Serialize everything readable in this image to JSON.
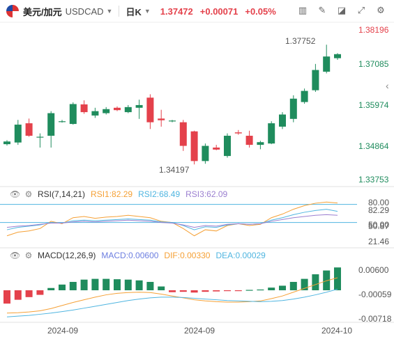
{
  "header": {
    "symbol": "美元/加元",
    "symbol_code": "USDCAD",
    "timeframe": "日K",
    "last_price": "1.37472",
    "change": "+0.00071",
    "change_pct": "+0.05%",
    "tools": [
      "candle-style-icon",
      "draw-icon",
      "drawing-tools-icon",
      "fullscreen-icon",
      "settings-icon"
    ]
  },
  "colors": {
    "up": "#1f8c5d",
    "down": "#e4414b",
    "rsi1": "#f5a035",
    "rsi2": "#4fb5e0",
    "rsi3": "#9b7fd0",
    "macd": "#6c7ee0",
    "dif": "#f5a035",
    "dea": "#4fb5e0"
  },
  "main_axis_labels": [
    "1.38196",
    "1.37085",
    "1.35974",
    "1.34864",
    "1.33753"
  ],
  "rsi_axis_labels": [
    "80.00",
    "82.29",
    "50.00",
    "50.87",
    "21.46"
  ],
  "macd_axis_labels": [
    "0.00600",
    "-0.00059",
    "-0.00718"
  ],
  "x_axis_labels": [
    "2024-09",
    "2024-09",
    "2024-10"
  ],
  "rsi_header": {
    "name": "RSI(7,14,21)",
    "rsi1": "RSI1:82.29",
    "rsi2": "RSI2:68.49",
    "rsi3": "RSI3:62.09"
  },
  "macd_header": {
    "name": "MACD(12,26,9)",
    "macd": "MACD:0.00600",
    "dif": "DIF:0.00330",
    "dea": "DEA:0.00029"
  },
  "chart_data": [
    {
      "type": "candlestick",
      "title": "",
      "ylim": [
        1.3375,
        1.3825
      ],
      "annotations": [
        {
          "text": "1.37752",
          "value": 1.37752
        },
        {
          "text": "1.34197",
          "value": 1.34197
        }
      ],
      "candles": [
        {
          "o": 1.348,
          "h": 1.3492,
          "l": 1.3476,
          "c": 1.3488
        },
        {
          "o": 1.3485,
          "h": 1.3552,
          "l": 1.3478,
          "c": 1.3538
        },
        {
          "o": 1.3542,
          "h": 1.3556,
          "l": 1.3502,
          "c": 1.3505
        },
        {
          "o": 1.35,
          "h": 1.3512,
          "l": 1.347,
          "c": 1.3502
        },
        {
          "o": 1.3505,
          "h": 1.3578,
          "l": 1.347,
          "c": 1.3572
        },
        {
          "o": 1.3548,
          "h": 1.3552,
          "l": 1.3544,
          "c": 1.3548
        },
        {
          "o": 1.354,
          "h": 1.3604,
          "l": 1.3538,
          "c": 1.3599
        },
        {
          "o": 1.3598,
          "h": 1.361,
          "l": 1.357,
          "c": 1.3575
        },
        {
          "o": 1.3565,
          "h": 1.3588,
          "l": 1.3558,
          "c": 1.3578
        },
        {
          "o": 1.3572,
          "h": 1.359,
          "l": 1.3568,
          "c": 1.3584
        },
        {
          "o": 1.3588,
          "h": 1.3592,
          "l": 1.3578,
          "c": 1.3581
        },
        {
          "o": 1.3575,
          "h": 1.3596,
          "l": 1.3572,
          "c": 1.359
        },
        {
          "o": 1.3588,
          "h": 1.3612,
          "l": 1.3555,
          "c": 1.3596
        },
        {
          "o": 1.3618,
          "h": 1.3628,
          "l": 1.3525,
          "c": 1.3545
        },
        {
          "o": 1.3556,
          "h": 1.3582,
          "l": 1.3532,
          "c": 1.3551
        },
        {
          "o": 1.3548,
          "h": 1.3552,
          "l": 1.3545,
          "c": 1.355
        },
        {
          "o": 1.3545,
          "h": 1.3552,
          "l": 1.346,
          "c": 1.3475
        },
        {
          "o": 1.3518,
          "h": 1.352,
          "l": 1.342,
          "c": 1.343
        },
        {
          "o": 1.343,
          "h": 1.3482,
          "l": 1.3422,
          "c": 1.3475
        },
        {
          "o": 1.347,
          "h": 1.3478,
          "l": 1.3462,
          "c": 1.3464
        },
        {
          "o": 1.3445,
          "h": 1.3512,
          "l": 1.344,
          "c": 1.3505
        },
        {
          "o": 1.3515,
          "h": 1.3522,
          "l": 1.3508,
          "c": 1.3512
        },
        {
          "o": 1.3505,
          "h": 1.352,
          "l": 1.347,
          "c": 1.3478
        },
        {
          "o": 1.3478,
          "h": 1.349,
          "l": 1.3465,
          "c": 1.3486
        },
        {
          "o": 1.3482,
          "h": 1.3548,
          "l": 1.348,
          "c": 1.3542
        },
        {
          "o": 1.3532,
          "h": 1.3575,
          "l": 1.3525,
          "c": 1.3568
        },
        {
          "o": 1.3555,
          "h": 1.3625,
          "l": 1.3545,
          "c": 1.3615
        },
        {
          "o": 1.3605,
          "h": 1.3645,
          "l": 1.36,
          "c": 1.3638
        },
        {
          "o": 1.364,
          "h": 1.3718,
          "l": 1.3635,
          "c": 1.37
        },
        {
          "o": 1.3695,
          "h": 1.3775,
          "l": 1.369,
          "c": 1.374
        },
        {
          "o": 1.3735,
          "h": 1.375,
          "l": 1.373,
          "c": 1.3747
        }
      ]
    },
    {
      "type": "line",
      "title": "RSI(7,14,21)",
      "ylim": [
        15,
        90
      ],
      "reference_lines": [
        80,
        50
      ],
      "series": [
        {
          "name": "RSI1",
          "values": [
            28,
            34,
            36,
            40,
            52,
            48,
            58,
            60,
            57,
            59,
            60,
            62,
            60,
            58,
            52,
            50,
            40,
            28,
            38,
            36,
            45,
            48,
            45,
            47,
            58,
            64,
            72,
            78,
            82,
            84,
            82.29
          ]
        },
        {
          "name": "RSI2",
          "values": [
            38,
            42,
            44,
            46,
            50,
            49,
            53,
            54,
            53,
            54,
            55,
            56,
            55,
            54,
            51,
            50,
            45,
            38,
            43,
            42,
            46,
            48,
            47,
            48,
            54,
            58,
            63,
            67,
            70,
            72,
            68.49
          ]
        },
        {
          "name": "RSI3",
          "values": [
            42,
            44,
            45,
            47,
            49,
            49,
            51,
            52,
            51,
            52,
            53,
            54,
            53,
            52,
            50,
            49,
            46,
            42,
            45,
            44,
            47,
            48,
            47,
            48,
            52,
            55,
            58,
            60,
            62,
            63,
            62.09
          ]
        }
      ]
    },
    {
      "type": "bar",
      "title": "MACD(12,26,9)",
      "ylim": [
        -0.0075,
        0.0075
      ],
      "series": [
        {
          "name": "MACD",
          "values": [
            -0.0035,
            -0.0025,
            -0.0018,
            -0.0012,
            0.0006,
            0.0015,
            0.0022,
            0.0028,
            0.003,
            0.003,
            0.0029,
            0.0028,
            0.0026,
            0.0022,
            0.001,
            -0.0005,
            -0.0004,
            -0.0006,
            -0.0004,
            -0.0003,
            -0.0002,
            -0.0001,
            0.0001,
            0.0002,
            0.0007,
            0.0012,
            0.0022,
            0.003,
            0.0042,
            0.0052,
            0.006
          ]
        },
        {
          "name": "DIF",
          "values": [
            -0.006,
            -0.0059,
            -0.0057,
            -0.0054,
            -0.0048,
            -0.004,
            -0.0032,
            -0.0025,
            -0.0018,
            -0.0012,
            -0.0008,
            -0.0006,
            -0.0005,
            -0.0006,
            -0.001,
            -0.0015,
            -0.002,
            -0.0025,
            -0.0028,
            -0.003,
            -0.0031,
            -0.0031,
            -0.003,
            -0.0028,
            -0.0022,
            -0.0015,
            -0.0005,
            0.0005,
            0.0015,
            0.0025,
            0.0033
          ]
        },
        {
          "name": "DEA",
          "values": [
            -0.007,
            -0.0068,
            -0.0066,
            -0.0063,
            -0.006,
            -0.0056,
            -0.0052,
            -0.0047,
            -0.0042,
            -0.0037,
            -0.0032,
            -0.0027,
            -0.0023,
            -0.002,
            -0.0018,
            -0.0018,
            -0.0019,
            -0.0021,
            -0.0023,
            -0.0025,
            -0.0027,
            -0.0028,
            -0.0029,
            -0.003,
            -0.0029,
            -0.0027,
            -0.0023,
            -0.0018,
            -0.0012,
            -0.0005,
            0.0003
          ]
        }
      ]
    }
  ]
}
